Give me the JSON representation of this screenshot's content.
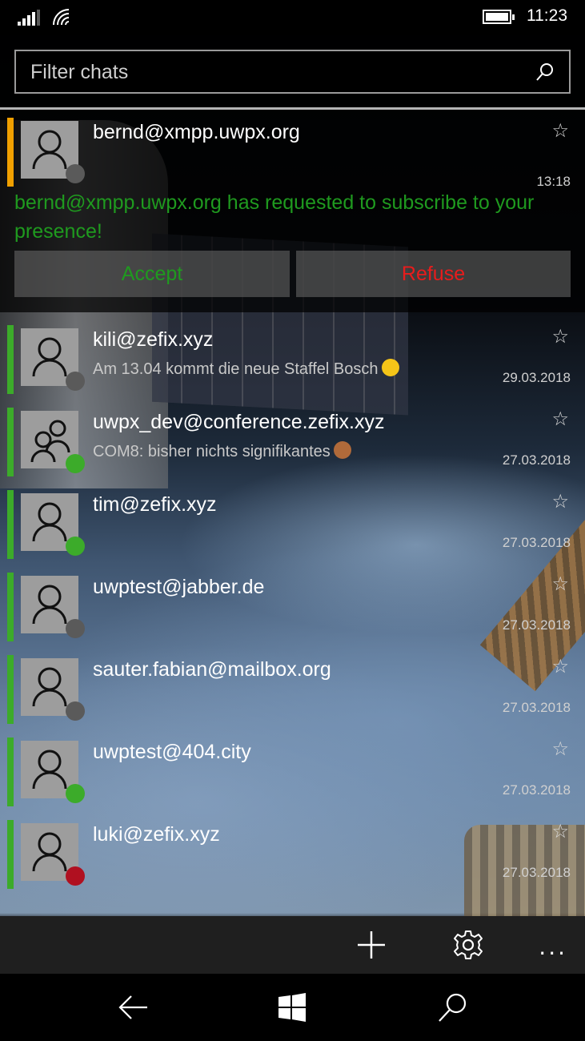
{
  "status_bar": {
    "time": "11:23",
    "signal_icon": "signal-bars-icon",
    "wifi_icon": "wifi-icon",
    "battery_icon": "battery-icon"
  },
  "filter": {
    "placeholder": "Filter chats",
    "icon": "search-icon"
  },
  "request": {
    "name": "bernd@xmpp.uwpx.org",
    "time": "13:18",
    "message": "bernd@xmpp.uwpx.org  has requested to subscribe to your presence!",
    "accept_label": "Accept",
    "refuse_label": "Refuse",
    "accent_color": "#f0a000",
    "presence": "offline"
  },
  "colors": {
    "online": "#3cab2a",
    "offline": "#5a5a5a",
    "busy": "#b01020",
    "accent_green": "#3cab2a",
    "accept": "#1f9a1f",
    "refuse": "#e81c1c"
  },
  "chats": [
    {
      "name": "kili@zefix.xyz",
      "message": "Am 13.04 kommt die neue Staffel Bosch",
      "emoji": "grinning-face-emoji",
      "time": "29.03.2018",
      "presence": "offline",
      "type": "person"
    },
    {
      "name": "uwpx_dev@conference.zefix.xyz",
      "message": "COM8: bisher nichts signifikantes",
      "emoji": "see-no-evil-monkey-emoji",
      "time": "27.03.2018",
      "presence": "online",
      "type": "group"
    },
    {
      "name": "tim@zefix.xyz",
      "message": "",
      "time": "27.03.2018",
      "presence": "online",
      "type": "person"
    },
    {
      "name": "uwptest@jabber.de",
      "message": "",
      "time": "27.03.2018",
      "presence": "offline",
      "type": "person"
    },
    {
      "name": "sauter.fabian@mailbox.org",
      "message": "",
      "time": "27.03.2018",
      "presence": "offline",
      "type": "person"
    },
    {
      "name": "uwptest@404.city",
      "message": "",
      "time": "27.03.2018",
      "presence": "online",
      "type": "person"
    },
    {
      "name": "luki@zefix.xyz",
      "message": "",
      "time": "27.03.2018",
      "presence": "busy",
      "type": "person"
    }
  ],
  "command_bar": {
    "add_icon": "plus-icon",
    "settings_icon": "gear-icon",
    "more_label": "..."
  },
  "nav_bar": {
    "back_icon": "back-arrow-icon",
    "home_icon": "windows-logo-icon",
    "search_icon": "search-icon"
  }
}
